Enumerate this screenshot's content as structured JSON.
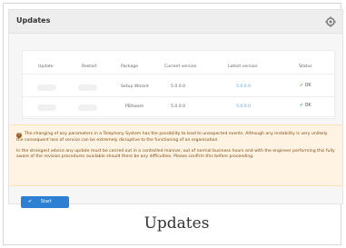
{
  "window": {
    "title": "Updates",
    "settings_icon": "gear-icon"
  },
  "table": {
    "headers": [
      "Update",
      "Restart",
      "Package",
      "Current version",
      "Latest version",
      "Status"
    ],
    "rows": [
      {
        "package": "Setup Wizard",
        "current_version": "5.0.0.0",
        "latest_version": "5.0.0.0",
        "status": "OK"
      },
      {
        "package": "PBXware",
        "current_version": "5.0.0.0",
        "latest_version": "5.0.0.0",
        "status": "OK"
      }
    ]
  },
  "notice": {
    "icon": "warning-icon",
    "paragraph_1": "The changing of any parameters in a Telephony System has the possibility to lead to unexpected events. Although any instability is very unlikely the consequent loss of service can be extremely disruptive to the functioning of an organisation.",
    "paragraph_2": "In the strongest advice any update must be carried out in a controlled manner, out of normal business hours and with the engineer performing this fully aware of the revision procedures available should there be any difficulties. Please confirm this before proceeding."
  },
  "actions": {
    "start_label": "Start",
    "start_icon": "check-icon"
  },
  "caption": "Updates",
  "colors": {
    "accent": "#2d7fd3",
    "link": "#5ea6e6",
    "ok": "#4caf50",
    "warning_bg": "#fff4e3",
    "warning_text": "#7a4b14"
  }
}
